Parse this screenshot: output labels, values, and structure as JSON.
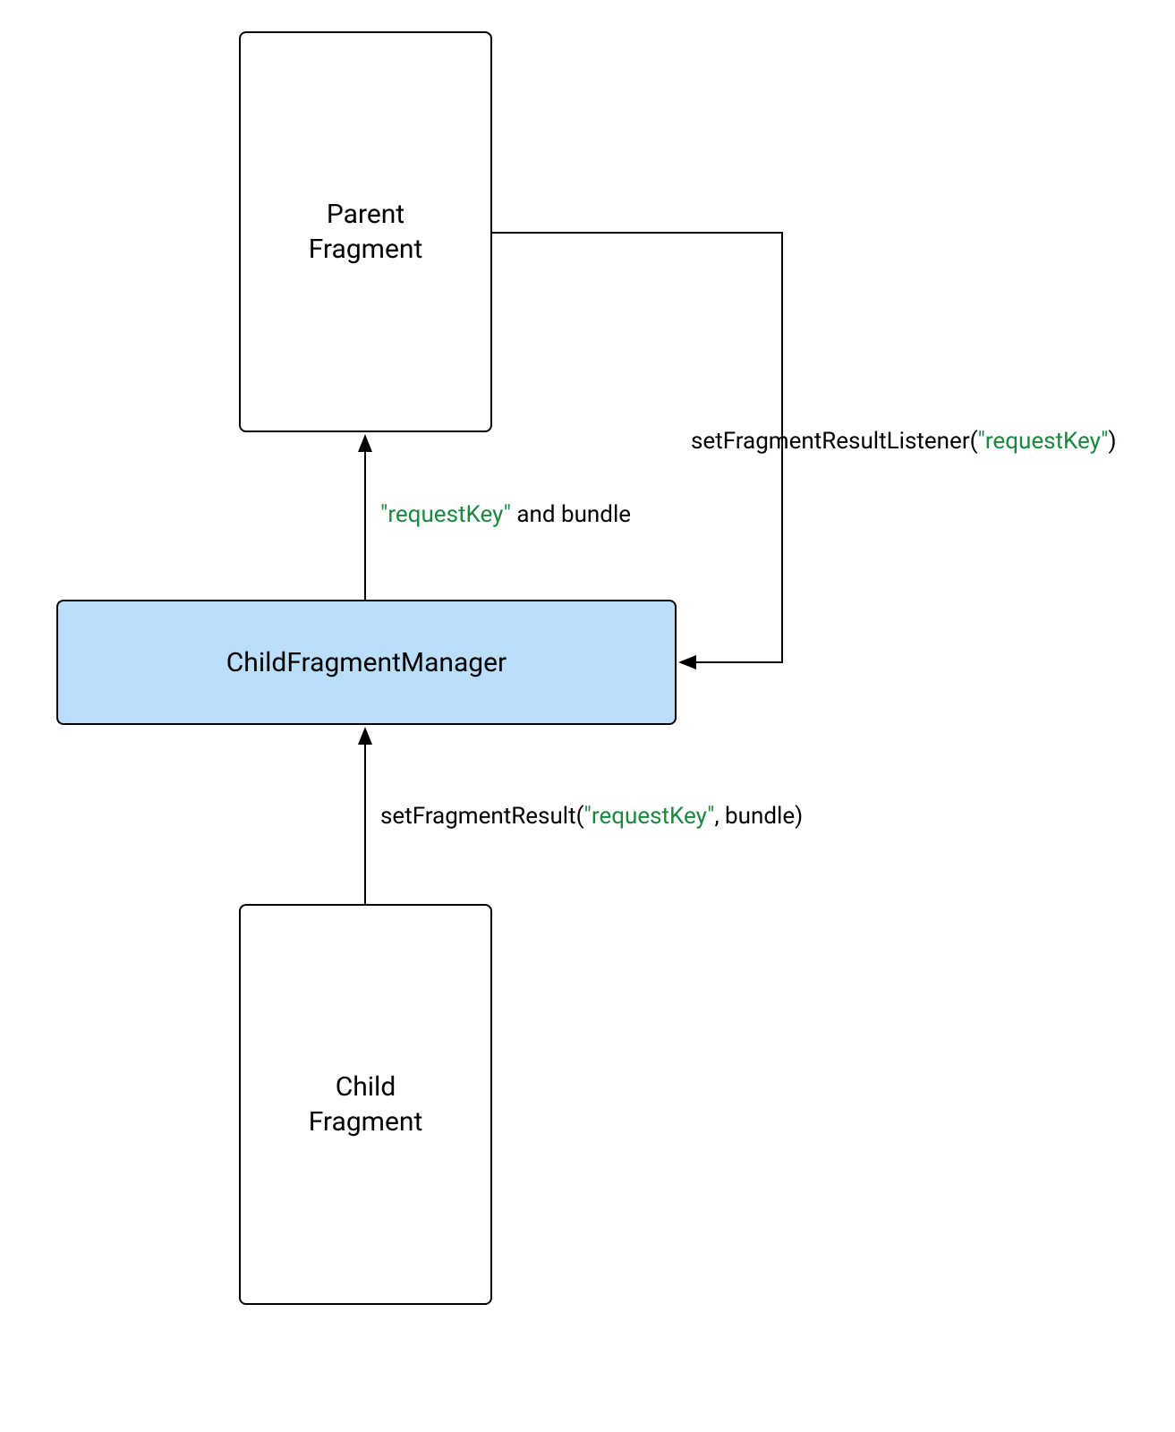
{
  "nodes": {
    "parent": {
      "line1": "Parent",
      "line2": "Fragment"
    },
    "manager": "ChildFragmentManager",
    "child": {
      "line1": "Child",
      "line2": "Fragment"
    }
  },
  "labels": {
    "listener": {
      "prefix": "setFragmentResultListener(",
      "key": "\"requestKey\"",
      "suffix": ")"
    },
    "upToParent": {
      "key": "\"requestKey\"",
      "suffix": " and bundle"
    },
    "setResult": {
      "prefix": "setFragmentResult(",
      "key": "\"requestKey\"",
      "suffix": ", bundle)"
    }
  }
}
